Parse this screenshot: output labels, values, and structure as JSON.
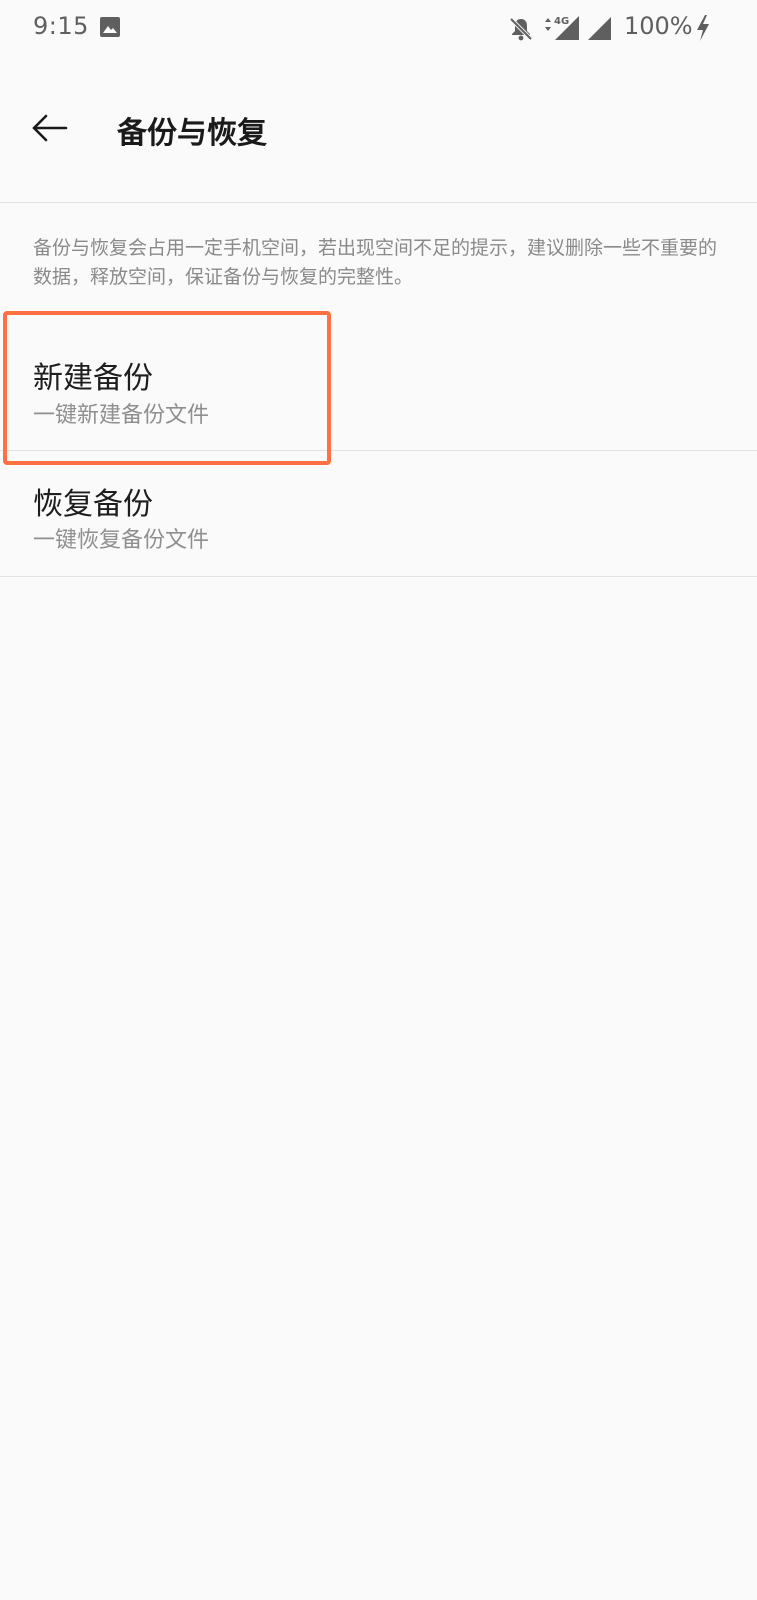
{
  "status_bar": {
    "time": "9:15",
    "battery_text": "100%",
    "network_label": "4G",
    "icons": [
      "gallery-icon",
      "notifications-muted-icon",
      "data-arrows-icon",
      "signal-icon",
      "signal-icon",
      "charging-bolt-icon"
    ]
  },
  "header": {
    "title": "备份与恢复",
    "back_icon": "arrow-left-icon"
  },
  "description": "备份与恢复会占用一定手机空间，若出现空间不足的提示，建议删除一些不重要的数据，释放空间，保证备份与恢复的完整性。",
  "items": [
    {
      "title": "新建备份",
      "subtitle": "一键新建备份文件"
    },
    {
      "title": "恢复备份",
      "subtitle": "一键恢复备份文件"
    }
  ],
  "colors": {
    "background": "#fafafa",
    "highlight": "#ff7043",
    "divider": "#e3e3e3",
    "secondary_text": "#8f8f8f"
  }
}
